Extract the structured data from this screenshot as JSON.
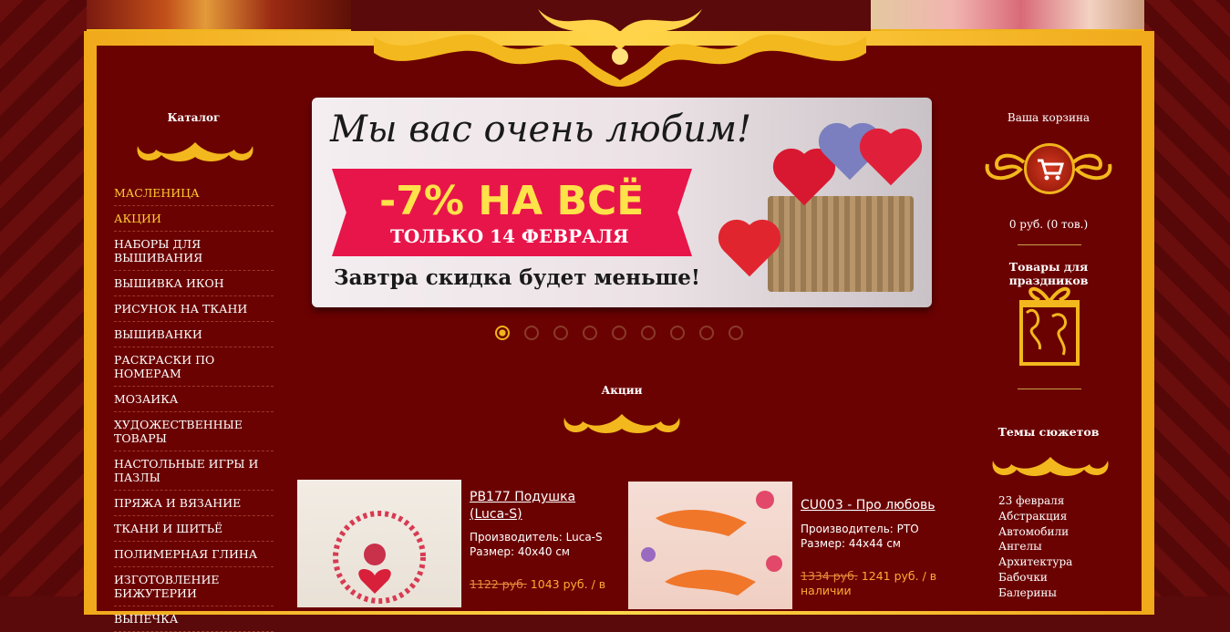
{
  "colors": {
    "accent": "#f0b41c",
    "background": "#6b0202",
    "highlight": "#ffcc33",
    "price": "#ffaa33"
  },
  "catalog": {
    "title": "Каталог",
    "items": [
      {
        "label": "МАСЛЕНИЦА",
        "highlighted": true
      },
      {
        "label": "АКЦИИ",
        "highlighted": true
      },
      {
        "label": "НАБОРЫ ДЛЯ ВЫШИВАНИЯ",
        "highlighted": false
      },
      {
        "label": "ВЫШИВКА ИКОН",
        "highlighted": false
      },
      {
        "label": "РИСУНОК НА ТКАНИ",
        "highlighted": false
      },
      {
        "label": "ВЫШИВАНКИ",
        "highlighted": false
      },
      {
        "label": "РАСКРАСКИ ПО НОМЕРАМ",
        "highlighted": false
      },
      {
        "label": "МОЗАИКА",
        "highlighted": false
      },
      {
        "label": "ХУДОЖЕСТВЕННЫЕ ТОВАРЫ",
        "highlighted": false
      },
      {
        "label": "НАСТОЛЬНЫЕ ИГРЫ И ПАЗЛЫ",
        "highlighted": false
      },
      {
        "label": "ПРЯЖА И ВЯЗАНИЕ",
        "highlighted": false
      },
      {
        "label": "ТКАНИ И ШИТЬЁ",
        "highlighted": false
      },
      {
        "label": "ПОЛИМЕРНАЯ ГЛИНА",
        "highlighted": false
      },
      {
        "label": "ИЗГОТОВЛЕНИЕ БИЖУТЕРИИ",
        "highlighted": false
      },
      {
        "label": "ВЫПЕЧКА",
        "highlighted": false
      }
    ]
  },
  "banner": {
    "headline": "Мы вас очень любим!",
    "discount": "-7% НА ВСЁ",
    "subline": "ТОЛЬКО 14 ФЕВРАЛЯ",
    "footer": "Завтра скидка будет меньше!",
    "slide_count": 9,
    "active_slide": 1
  },
  "promo_section": {
    "title": "Акции"
  },
  "products": [
    {
      "title": "PB177 Подушка (Luca-S)",
      "manufacturer": "Производитель: Luca-S",
      "size": "Размер: 40x40 см",
      "old_price": "1122 руб.",
      "new_price": "1043 руб. / в"
    },
    {
      "title": "CU003 - Про любовь",
      "manufacturer": "Производитель: РТО",
      "size": "Размер: 44x44 см",
      "old_price": "1334 руб.",
      "new_price": "1241 руб. / в",
      "availability": "наличии"
    }
  ],
  "cart": {
    "title": "Ваша корзина",
    "summary": "0 руб.   (0 тов.)",
    "icon": "cart-icon"
  },
  "holidays": {
    "title": "Товары для праздников",
    "icon": "gift-icon"
  },
  "themes": {
    "title": "Темы сюжетов",
    "items": [
      "23 февраля",
      "Абстракция",
      "Автомобили",
      "Ангелы",
      "Архитектура",
      "Бабочки",
      "Балерины"
    ]
  }
}
